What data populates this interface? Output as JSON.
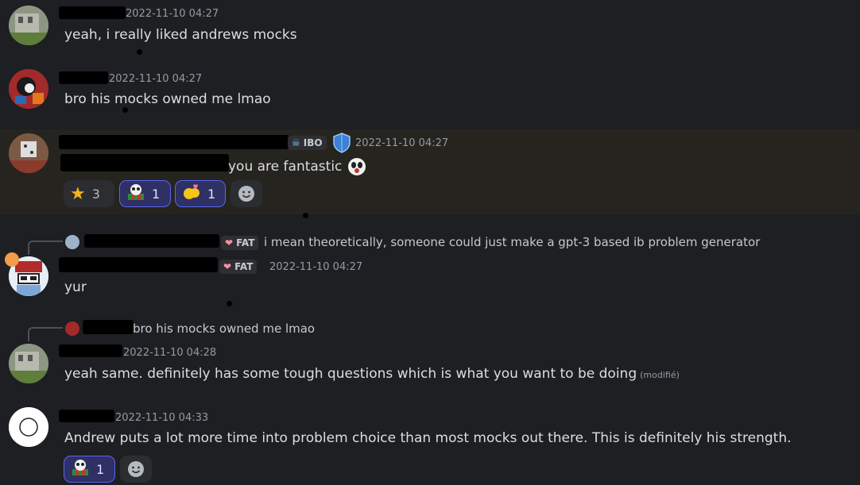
{
  "messages": [
    {
      "timestamp": "2022-11-10 04:27",
      "text": "yeah, i really liked andrews mocks"
    },
    {
      "timestamp": "2022-11-10 04:27",
      "text": "bro his mocks owned me lmao"
    },
    {
      "timestamp": "2022-11-10 04:27",
      "role_tag": "IBO",
      "text": "you are fantastic",
      "reactions": [
        {
          "icon": "star-emoji",
          "count": "3"
        },
        {
          "icon": "panda-emoji",
          "count": "1"
        },
        {
          "icon": "hug-emoji",
          "count": "1"
        }
      ]
    },
    {
      "reply_tag": "FAT",
      "reply_text": "i mean theoretically, someone could just make a gpt-3 based ib problem generator",
      "role_tag": "FAT",
      "timestamp": "2022-11-10 04:27",
      "text": "yur"
    },
    {
      "reply_text": "bro his mocks owned me lmao",
      "timestamp": "2022-11-10 04:28",
      "text": "yeah same. definitely has some tough questions which is what you want to be doing",
      "edited": "(modifié)"
    },
    {
      "timestamp": "2022-11-10 04:33",
      "text": "Andrew puts a lot more time into problem choice than most mocks out there. This is definitely his strength.",
      "reactions": [
        {
          "icon": "panda-emoji",
          "count": "1"
        }
      ]
    }
  ],
  "colors": {
    "background": "#1e1f22",
    "highlight": "#26241f",
    "accent": "#5865f2",
    "shield": "#3b82d6"
  }
}
